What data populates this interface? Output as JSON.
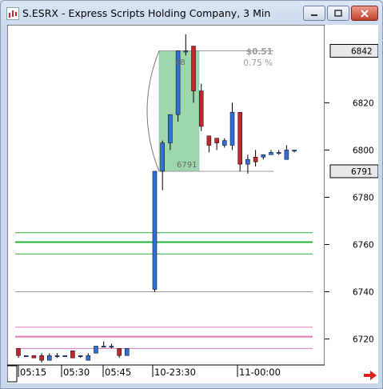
{
  "window": {
    "title": "S.ESRX - Express Scripts Holding Company, 3 Min"
  },
  "colors": {
    "up": "#2f6fd6",
    "down": "#c1272d",
    "green_line": "#22b33a",
    "pink_line": "#e27bb8",
    "gray_line": "#9a9a9a",
    "highlight": "#8fd19e"
  },
  "annotation": {
    "price_change": "$0.51",
    "pct_change": "0.75 %",
    "low_label": "6791",
    "high_label": "68",
    "high_label_suffix": "42"
  },
  "price_tags": {
    "last": "6842",
    "current": "6791"
  },
  "chart_data": {
    "type": "candlestick",
    "y_ticks": [
      6720,
      6740,
      6760,
      6780,
      6800,
      6820
    ],
    "ylim": [
      6709,
      6853
    ],
    "x_ticks": [
      "05:15",
      "05:30",
      "05:45",
      "10-23:30",
      "11-00:00"
    ],
    "candles": [
      {
        "o": 6716,
        "h": 6716,
        "l": 6712,
        "c": 6713
      },
      {
        "o": 6713,
        "h": 6713,
        "l": 6713,
        "c": 6713
      },
      {
        "o": 6713,
        "h": 6713,
        "l": 6712,
        "c": 6712
      },
      {
        "o": 6713,
        "h": 6714,
        "l": 6710,
        "c": 6711
      },
      {
        "o": 6711,
        "h": 6714,
        "l": 6711,
        "c": 6713
      },
      {
        "o": 6713,
        "h": 6714,
        "l": 6712,
        "c": 6713
      },
      {
        "o": 6713,
        "h": 6713,
        "l": 6713,
        "c": 6713
      },
      {
        "o": 6715,
        "h": 6715,
        "l": 6712,
        "c": 6712
      },
      {
        "o": 6713,
        "h": 6713,
        "l": 6712,
        "c": 6713
      },
      {
        "o": 6711,
        "h": 6714,
        "l": 6711,
        "c": 6713
      },
      {
        "o": 6714,
        "h": 6717,
        "l": 6714,
        "c": 6717
      },
      {
        "o": 6717,
        "h": 6719,
        "l": 6717,
        "c": 6717
      },
      {
        "o": 6717,
        "h": 6718,
        "l": 6716,
        "c": 6717
      },
      {
        "o": 6716,
        "h": 6716,
        "l": 6712,
        "c": 6713
      },
      {
        "o": 6713,
        "h": 6716,
        "l": 6713,
        "c": 6716
      },
      {
        "o": 6741,
        "h": 6791,
        "l": 6740,
        "c": 6791
      },
      {
        "o": 6791,
        "h": 6804,
        "l": 6783,
        "c": 6803
      },
      {
        "o": 6803,
        "h": 6815,
        "l": 6800,
        "c": 6815
      },
      {
        "o": 6815,
        "h": 6842,
        "l": 6812,
        "c": 6842
      },
      {
        "o": 6842,
        "h": 6849,
        "l": 6840,
        "c": 6842
      },
      {
        "o": 6844,
        "h": 6844,
        "l": 6820,
        "c": 6825
      },
      {
        "o": 6825,
        "h": 6828,
        "l": 6808,
        "c": 6810
      },
      {
        "o": 6806,
        "h": 6806,
        "l": 6799,
        "c": 6802
      },
      {
        "o": 6805,
        "h": 6805,
        "l": 6800,
        "c": 6803
      },
      {
        "o": 6802,
        "h": 6805,
        "l": 6801,
        "c": 6804
      },
      {
        "o": 6802,
        "h": 6820,
        "l": 6800,
        "c": 6816
      },
      {
        "o": 6816,
        "h": 6816,
        "l": 6791,
        "c": 6794
      },
      {
        "o": 6794,
        "h": 6798,
        "l": 6790,
        "c": 6796
      },
      {
        "o": 6797,
        "h": 6800,
        "l": 6793,
        "c": 6795
      },
      {
        "o": 6797,
        "h": 6798,
        "l": 6796,
        "c": 6798
      },
      {
        "o": 6798,
        "h": 6800,
        "l": 6798,
        "c": 6799
      },
      {
        "o": 6799,
        "h": 6800,
        "l": 6798,
        "c": 6799
      },
      {
        "o": 6796,
        "h": 6802,
        "l": 6796,
        "c": 6800
      },
      {
        "o": 6800,
        "h": 6800,
        "l": 6799,
        "c": 6800
      }
    ],
    "levels": {
      "green": [
        6765,
        6761,
        6756
      ],
      "gray": [
        6740
      ],
      "pink": [
        6725,
        6721,
        6716
      ]
    }
  }
}
